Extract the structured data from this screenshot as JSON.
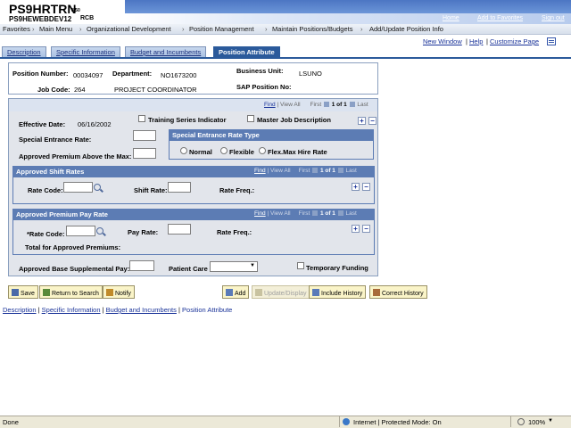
{
  "header": {
    "app_title": "PS9HRTRN",
    "app_version": "8.50",
    "database": "PS9HEWEBDEV12",
    "user": "RCB",
    "links": [
      "Home",
      "Add to Favorites",
      "Sign out"
    ]
  },
  "breadcrumb": [
    "Favorites",
    "Main Menu",
    "Organizational Development",
    "Position Management",
    "Maintain Positions/Budgets",
    "Add/Update Position Info"
  ],
  "page_links": {
    "new_window": "New Window",
    "help": "Help",
    "customize": "Customize Page",
    "sep": "|"
  },
  "tabs": [
    "Description",
    "Specific Information",
    "Budget and Incumbents",
    "Position Attribute"
  ],
  "info": {
    "position_number_label": "Position Number:",
    "position_number": "00034097",
    "department_label": "Department:",
    "department": "NO1673200",
    "business_unit_label": "Business Unit:",
    "business_unit": "LSUNO",
    "job_code_label": "Job Code:",
    "job_code": "264",
    "job_title": "PROJECT COORDINATOR",
    "sap_label": "SAP Position No:"
  },
  "nav": {
    "find": "Find",
    "view_all": "View All",
    "first": "First",
    "range": "1 of 1",
    "last": "Last",
    "sep": "|"
  },
  "main": {
    "effective_date_label": "Effective Date:",
    "effective_date": "06/16/2002",
    "training_label": "Training Series Indicator",
    "master_job_label": "Master Job Description",
    "special_rate_label": "Special Entrance Rate:",
    "approved_premium_label": "Approved Premium Above the Max:",
    "rate_type_title": "Special Entrance Rate Type",
    "rate_type_options": [
      "Normal",
      "Flexible",
      "Flex.Max Hire Rate"
    ],
    "shift_title": "Approved Shift Rates",
    "rate_code_label": "Rate Code:",
    "shift_rate_label": "Shift Rate:",
    "rate_freq_label": "Rate Freq.:",
    "premium_title": "Approved Premium Pay Rate",
    "req_rate_code_label": "*Rate Code:",
    "pay_rate_label": "Pay Rate:",
    "total_premiums_label": "Total for Approved Premiums:",
    "base_supp_label": "Approved Base Supplemental Pay:",
    "patient_care_label": "Patient Care",
    "temp_funding_label": "Temporary Funding"
  },
  "buttons": {
    "save": "Save",
    "return": "Return to Search",
    "notify": "Notify",
    "add": "Add",
    "update": "Update/Display",
    "include_history": "Include History",
    "correct_history": "Correct History"
  },
  "footer_links": [
    "Description",
    "Specific Information",
    "Budget and Incumbents",
    "Position Attribute"
  ],
  "footer_sep": "|",
  "status": {
    "text": "Done",
    "zone": "Internet | Protected Mode: On",
    "zoom": "100%"
  },
  "colors": {
    "header_blue": "#4c76c3",
    "tab_active": "#2b5a9b",
    "section_header": "#5c7cb4",
    "button_bg": "#faf4c8"
  }
}
